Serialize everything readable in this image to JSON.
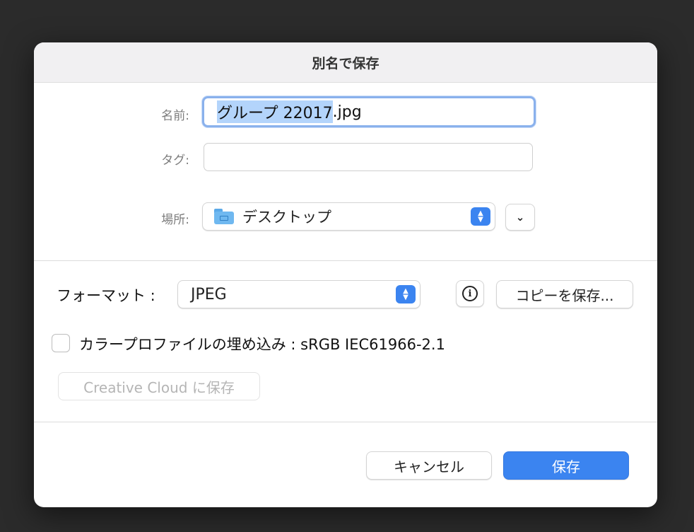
{
  "dialog": {
    "title": "別名で保存"
  },
  "name_row": {
    "label": "名前:",
    "value_selected": "グループ 22017",
    "value_rest": ".jpg"
  },
  "tags_row": {
    "label": "タグ:",
    "value": ""
  },
  "location_row": {
    "label": "場所:",
    "value": "デスクトップ",
    "icon": "folder-icon",
    "expand_icon": "chevron-down-icon"
  },
  "format_row": {
    "label": "フォーマット :",
    "value": "JPEG",
    "info_icon": "info-icon",
    "copy_button": "コピーを保存..."
  },
  "embed_profile": {
    "checked": false,
    "label": "カラープロファイルの埋め込み : sRGB IEC61966-2.1"
  },
  "creative_cloud_button": "Creative Cloud に保存",
  "footer": {
    "cancel_label": "キャンセル",
    "save_label": "保存"
  },
  "colors": {
    "accent": "#3b84f0",
    "selection": "#b3d4fb",
    "focus_ring": "#8ab1ec",
    "background": "#2b2b2b"
  }
}
